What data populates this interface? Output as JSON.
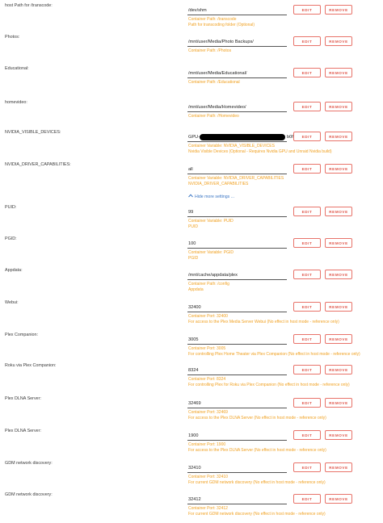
{
  "buttons": {
    "edit": "EDIT",
    "remove": "REMOVE"
  },
  "more_settings": "Hide more settings ...",
  "rows": [
    {
      "label": "host Path for /transcode:",
      "value": "/dev/shm",
      "desc": [
        "Container Path: /transcode",
        "Path for transcoding folder (Optional)"
      ]
    },
    {
      "label": "Photos:",
      "value": "/mnt/user/Media/Photo Backups/",
      "desc": [
        "Container Path: /Photos"
      ]
    },
    {
      "label": "Educational:",
      "value": "/mnt/user/Media/Educational/",
      "desc": [
        "Container Path: /Educational"
      ]
    },
    {
      "label": "homevideo:",
      "value": "/mnt/user/Media/Homevideo/",
      "desc": [
        "Container Path: /Homevideo"
      ]
    },
    {
      "label": "NVIDIA_VISIBLE_DEVICES:",
      "value": "GPU-",
      "value_suffix": "b0fe",
      "desc": [
        "Container Variable: NVIDIA_VISIBLE_DEVICES",
        "Nvidia Visible Devices (Optional - Requires Nvidia GPU and Unraid Nvidia build)"
      ]
    },
    {
      "label": "NVIDIA_DRIVER_CAPABILITIES:",
      "value": "all",
      "desc": [
        "Container Variable: NVIDIA_DRIVER_CAPABILITIES",
        "NVIDIA_DRIVER_CAPABILITIES"
      ]
    },
    {
      "label": "PUID:",
      "value": "99",
      "desc": [
        "Container Variable: PUID",
        "PUID"
      ]
    },
    {
      "label": "PGID:",
      "value": "100",
      "desc": [
        "Container Variable: PGID",
        "PGID"
      ]
    },
    {
      "label": "Appdata:",
      "value": "/mnt/cache/appdata/plex",
      "desc": [
        "Container Path: /config",
        "Appdata"
      ]
    },
    {
      "label": "Webui:",
      "value": "32400",
      "desc": [
        "Container Port: 32400",
        "For access to the Plex Media Server Webui (No effect in host mode - reference only)"
      ]
    },
    {
      "label": "Plex Companion:",
      "value": "3005",
      "desc": [
        "Container Port: 3005",
        "For controlling Plex Home Theater via Plex Companion (No effect in host mode - reference only)"
      ]
    },
    {
      "label": "Roku via Plex Companion:",
      "value": "8324",
      "desc": [
        "Container Port: 8324",
        "For controlling Plex for Roku via Plex Companion (No effect in host mode - reference only)"
      ]
    },
    {
      "label": "Plex DLNA Server:",
      "value": "32469",
      "desc": [
        "Container Port: 32469",
        "For access to the Plex DLNA Server (No effect in host mode - reference only)"
      ]
    },
    {
      "label": "Plex DLNA Server:",
      "value": "1900",
      "desc": [
        "Container Port: 1900",
        "For access to the Plex DLNA Server (No effect in host mode - reference only)"
      ]
    },
    {
      "label": "GDM network discovery:",
      "value": "32410",
      "desc": [
        "Container Port: 32410",
        "For current GDM network discovery (No effect in host mode - reference only)"
      ]
    },
    {
      "label": "GDM network discovery:",
      "value": "32412",
      "desc": [
        "Container Port: 32412",
        "For current GDM network discovery (No effect in host mode - reference only)"
      ]
    }
  ]
}
